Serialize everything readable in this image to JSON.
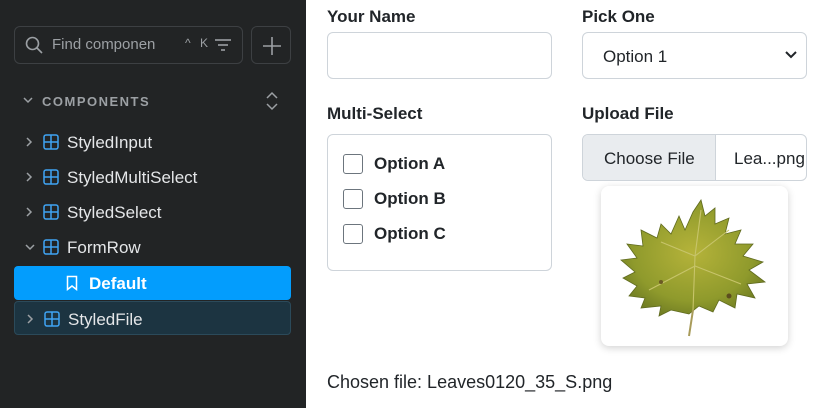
{
  "sidebar": {
    "search_placeholder": "Find componen",
    "search_shortcut": "^ K",
    "section_title": "COMPONENTS",
    "items": [
      {
        "label": "StyledInput"
      },
      {
        "label": "StyledMultiSelect"
      },
      {
        "label": "StyledSelect"
      },
      {
        "label": "FormRow"
      },
      {
        "label": "Default"
      },
      {
        "label": "StyledFile"
      }
    ]
  },
  "form": {
    "name_label": "Your Name",
    "name_value": "",
    "pick_label": "Pick One",
    "pick_value": "Option 1",
    "multi_label": "Multi-Select",
    "options": [
      {
        "label": "Option A",
        "checked": false
      },
      {
        "label": "Option B",
        "checked": false
      },
      {
        "label": "Option C",
        "checked": false
      }
    ],
    "upload_label": "Upload File",
    "choose_label": "Choose File",
    "file_name": "Lea...png",
    "chosen_text": "Chosen file: Leaves0120_35_S.png"
  },
  "colors": {
    "sidebar_bg": "#222425",
    "accent": "#039dfd",
    "icon_blue": "#3fa4f4"
  }
}
